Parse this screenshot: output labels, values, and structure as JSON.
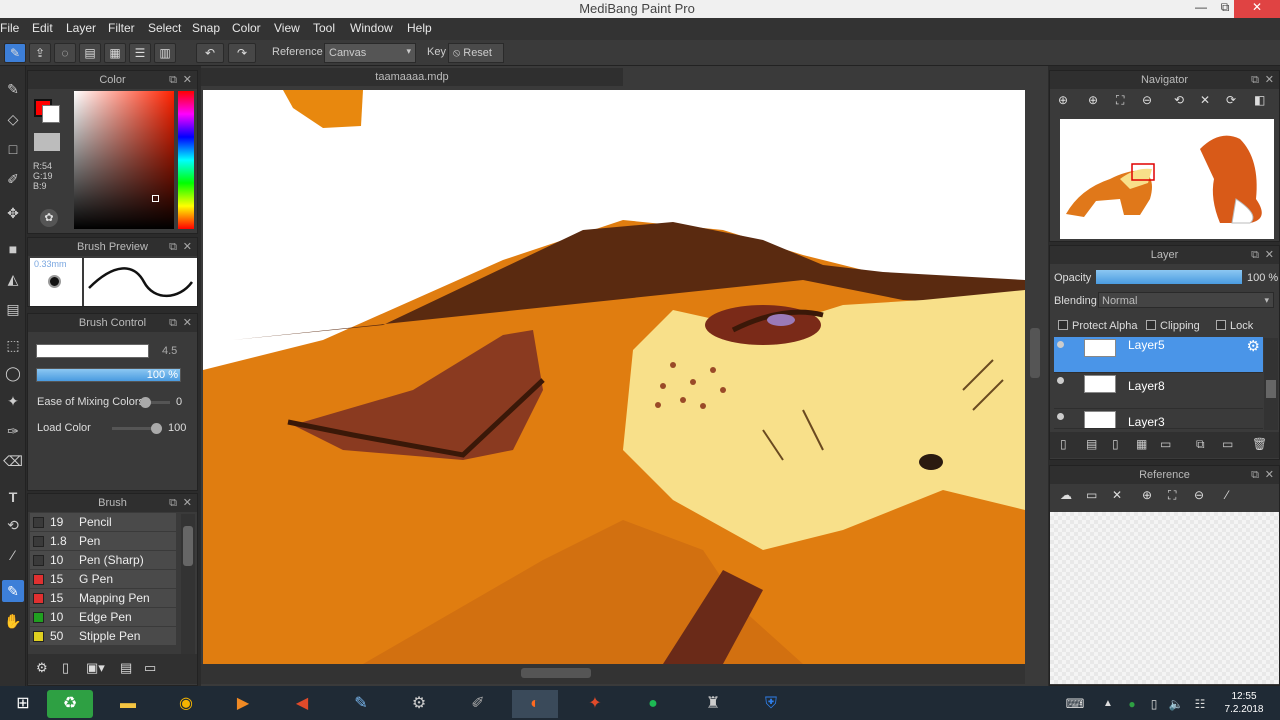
{
  "window": {
    "title": "MediBang Paint Pro",
    "minimize": "—",
    "maximize": "⧉",
    "close": "✕"
  },
  "menu": [
    "File",
    "Edit",
    "Layer",
    "Filter",
    "Select",
    "Snap",
    "Color",
    "View",
    "Tool",
    "Window",
    "Help"
  ],
  "toolbar": {
    "reference_label": "Reference",
    "reference_value": "Canvas",
    "key_label": "Key",
    "reset_label": "Reset"
  },
  "document": {
    "tab": "taamaaaa.mdp"
  },
  "color_panel": {
    "title": "Color",
    "r": "R:54",
    "g": "G:19",
    "b": "B:9",
    "primary": "#ff0000",
    "secondary": "#ffffff"
  },
  "brush_preview": {
    "title": "Brush Preview",
    "size": "0.33mm"
  },
  "brush_control": {
    "title": "Brush Control",
    "size": "4.5",
    "opacity": "100 %",
    "mix_label": "Ease of Mixing Colors",
    "mix_value": "0",
    "load_label": "Load Color",
    "load_value": "100",
    "opacity_level": 1.0,
    "mix_level": 0.0,
    "load_level": 1.0
  },
  "brush_panel": {
    "title": "Brush",
    "items": [
      {
        "size": "19",
        "name": "Pencil",
        "color": "#3a3a3a"
      },
      {
        "size": "1.8",
        "name": "Pen",
        "color": "#3a3a3a"
      },
      {
        "size": "10",
        "name": "Pen (Sharp)",
        "color": "#3a3a3a"
      },
      {
        "size": "15",
        "name": "G Pen",
        "color": "#e03030"
      },
      {
        "size": "15",
        "name": "Mapping Pen",
        "color": "#e03030"
      },
      {
        "size": "10",
        "name": "Edge Pen",
        "color": "#20a020"
      },
      {
        "size": "50",
        "name": "Stipple Pen",
        "color": "#e0d020"
      }
    ]
  },
  "navigator": {
    "title": "Navigator"
  },
  "layer_panel": {
    "title": "Layer",
    "opacity_label": "Opacity",
    "opacity_value": "100 %",
    "opacity_level": 1.0,
    "blending_label": "Blending",
    "blending_value": "Normal",
    "protect_alpha": "Protect Alpha",
    "clipping": "Clipping",
    "lock": "Lock",
    "layers": [
      {
        "name": "Layer5",
        "selected": true
      },
      {
        "name": "Layer8",
        "selected": false
      },
      {
        "name": "Layer3",
        "selected": false
      }
    ]
  },
  "reference_panel": {
    "title": "Reference"
  },
  "taskbar": {
    "time": "12:55",
    "date": "7.2.2018"
  }
}
